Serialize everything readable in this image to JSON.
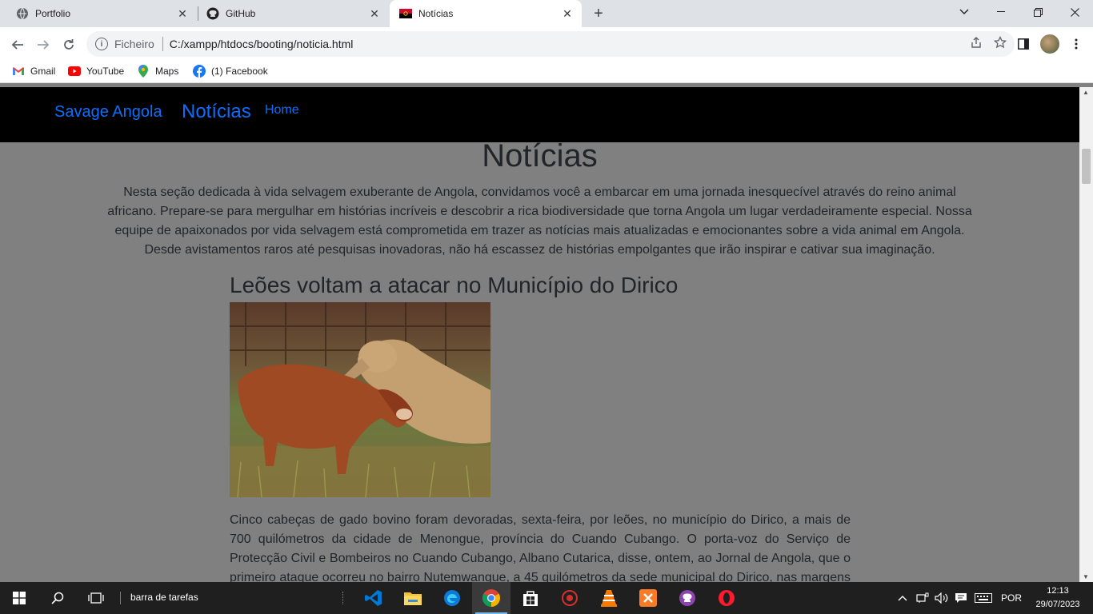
{
  "browser": {
    "tabs": [
      {
        "title": "Portfolio",
        "icon": "globe-icon"
      },
      {
        "title": "GitHub",
        "icon": "github-icon"
      },
      {
        "title": "Notícias",
        "icon": "angola-flag-icon",
        "active": true
      }
    ],
    "address": {
      "scheme_label": "Ficheiro",
      "url": "C:/xampp/htdocs/booting/noticia.html"
    },
    "bookmarks": [
      {
        "label": "Gmail",
        "icon": "gmail-icon"
      },
      {
        "label": "YouTube",
        "icon": "youtube-icon"
      },
      {
        "label": "Maps",
        "icon": "maps-icon"
      },
      {
        "label": "(1) Facebook",
        "icon": "facebook-icon"
      }
    ]
  },
  "site": {
    "brand": "Savage Angola",
    "nav_title": "Notícias",
    "nav_home": "Home",
    "heading": "Notícias",
    "intro": "Nesta seção dedicada à vida selvagem exuberante de Angola, convidamos você a embarcar em uma jornada inesquecível através do reino animal africano. Prepare-se para mergulhar em histórias incríveis e descobrir a rica biodiversidade que torna Angola um lugar verdadeiramente especial. Nossa equipe de apaixonados por vida selvagem está comprometida em trazer as notícias mais atualizadas e emocionantes sobre a vida animal em Angola. Desde avistamentos raros até pesquisas inovadoras, não há escassez de histórias empolgantes que irão inspirar e cativar sua imaginação.",
    "article": {
      "title": "Leões voltam a atacar no Município do Dirico",
      "body": "Cinco cabeças de gado bovino foram devoradas, sexta-feira, por leões, no município do Dirico, a mais de 700 quilómetros da cidade de Menongue, província do Cuando Cubango. O porta-voz do Serviço de Protecção Civil e Bombeiros no Cuando Cubango, Albano Cutarica, disse, ontem, ao Jornal de Angola, que o primeiro ataque ocorreu no bairro Nutemwangue, a 45 quilómetros da sede municipal do Dirico, nas margens do rio"
    }
  },
  "taskbar": {
    "search_text": "barra de tarefas",
    "apps": [
      "vscode-icon",
      "file-explorer-icon",
      "edge-icon",
      "chrome-icon",
      "store-icon",
      "app-red-icon",
      "vlc-icon",
      "xampp-icon",
      "github-desktop-icon",
      "opera-icon"
    ],
    "language": "POR",
    "time": "12:13",
    "date": "29/07/2023"
  },
  "colors": {
    "link_blue": "#0d6efd",
    "overlay_gray": "#808080",
    "nav_black": "#000000"
  }
}
